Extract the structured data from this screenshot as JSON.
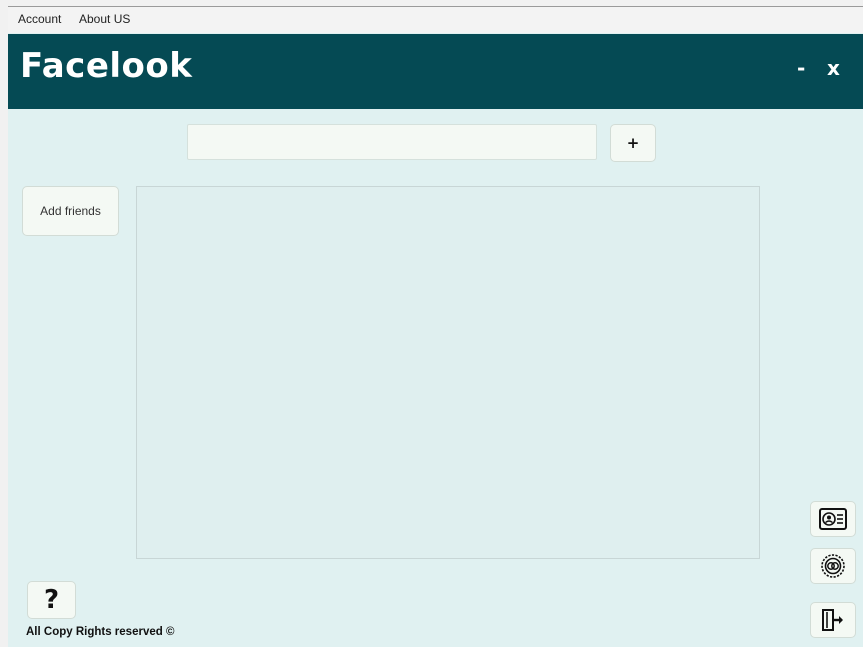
{
  "menubar": {
    "items": [
      {
        "label": "Account"
      },
      {
        "label": "About US"
      }
    ]
  },
  "header": {
    "title": "Facelook",
    "minimize_label": "-",
    "close_label": "x",
    "background": "#054a54"
  },
  "search": {
    "value": "",
    "placeholder": "",
    "add_label": "+"
  },
  "sidebar": {
    "add_friends_label": "Add friends"
  },
  "content": {
    "items": []
  },
  "help": {
    "label": "?"
  },
  "footer": {
    "text": "All Copy Rights reserved ©"
  },
  "side_actions": [
    {
      "icon": "profile-card-icon"
    },
    {
      "icon": "settings-icon"
    },
    {
      "icon": "logout-icon"
    }
  ],
  "colors": {
    "accent": "#054a54",
    "background": "#e0f1f1",
    "button": "#f4f9f4"
  }
}
